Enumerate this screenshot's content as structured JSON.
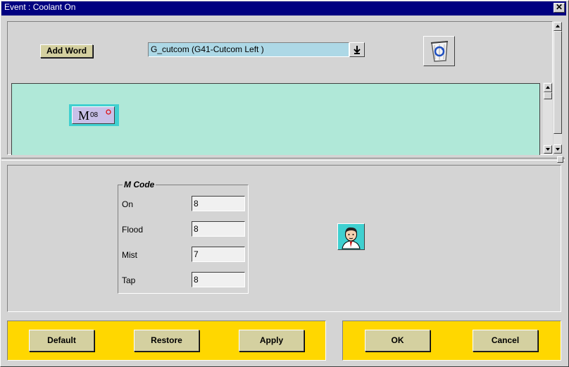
{
  "window": {
    "title": "Event : Coolant On",
    "close_glyph": "✕"
  },
  "toolbar": {
    "add_word_label": "Add Word",
    "word_combo": {
      "value": "G_cutcom (G41-Cutcom Left )",
      "arrow": "⬇"
    }
  },
  "word_chip": {
    "letter": "M",
    "number": "08"
  },
  "mcode_group": {
    "title": "M Code",
    "fields": [
      {
        "label": "On",
        "value": "8"
      },
      {
        "label": "Flood",
        "value": "8"
      },
      {
        "label": "Mist",
        "value": "7"
      },
      {
        "label": "Tap",
        "value": "8"
      }
    ]
  },
  "buttons": {
    "default": "Default",
    "restore": "Restore",
    "apply": "Apply",
    "ok": "OK",
    "cancel": "Cancel"
  },
  "colors": {
    "titlebar": "#000080",
    "word_area": "#b0e8d8",
    "combo": "#add8e6",
    "chip": "#c8c0e8",
    "footer": "#ffd700"
  },
  "icons": [
    "close-icon",
    "dropdown-arrow-icon",
    "recycle-bin-icon",
    "user-avatar-icon",
    "scroll-up-icon",
    "scroll-down-icon"
  ]
}
